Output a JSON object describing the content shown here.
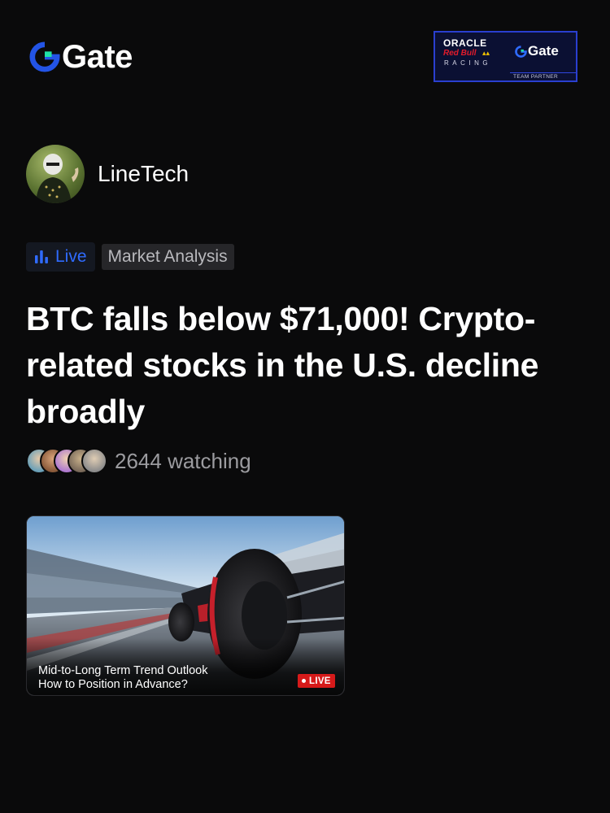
{
  "header": {
    "brand": "Gate",
    "brand_color": "#2354e6",
    "partner": {
      "oracle": "ORACLE",
      "redbull": "Red Bull",
      "racing": "RACING",
      "gate": "Gate",
      "footer": "TEAM PARTNER"
    }
  },
  "author": {
    "name": "LineTech"
  },
  "tags": {
    "live_label": "Live",
    "live_icon": "bar-chart-icon",
    "category": "Market Analysis"
  },
  "post": {
    "headline": "BTC falls below $71,000! Crypto-related stocks in the U.S. decline broadly"
  },
  "viewers": {
    "text": "2644 watching"
  },
  "video": {
    "title_line1": "Mid-to-Long Term Trend Outlook",
    "title_line2": "How to Position in Advance?",
    "badge": "LIVE",
    "badge_color": "#d61a1a"
  }
}
